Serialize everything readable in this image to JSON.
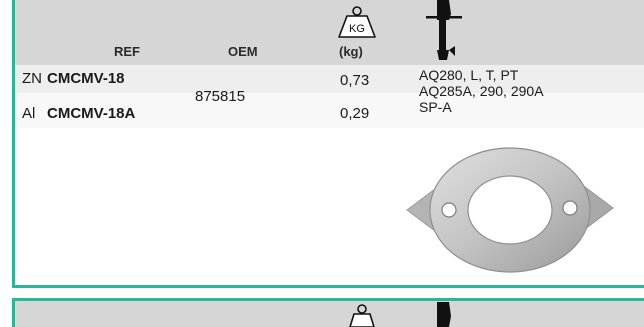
{
  "header": {
    "ref_label": "REF",
    "oem_label": "OEM",
    "weight_icon_text": "KG",
    "weight_unit": "(kg)",
    "engine_icon": "outboard-motor-icon"
  },
  "rows": [
    {
      "material": "ZN",
      "ref": "CMCMV-18",
      "weight": "0,73"
    },
    {
      "material": "Al",
      "ref": "CMCMV-18A",
      "weight": "0,29"
    }
  ],
  "oem": "875815",
  "applications": [
    "AQ280, L, T, PT",
    "AQ285A, 290, 290A",
    "SP-A"
  ],
  "product_image": "anode-ring-icon",
  "colors": {
    "accent": "#2bb59a",
    "header_bg": "#d6d6d6"
  }
}
